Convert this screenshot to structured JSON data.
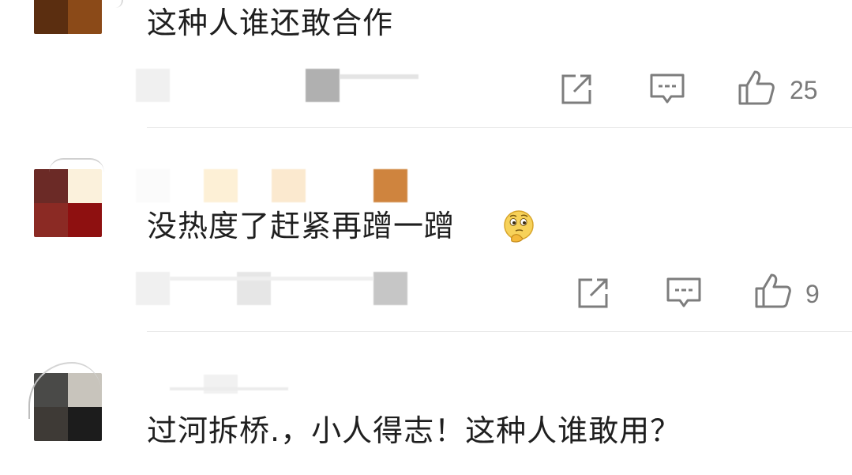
{
  "comments": [
    {
      "text": "这种人谁还敢合作",
      "like_count": "25"
    },
    {
      "text": "没热度了赶紧再蹭一蹭",
      "emoji": "thinking-face-emoji",
      "like_count": "9"
    },
    {
      "text": "过河拆桥.，小人得志！这种人谁敢用？"
    }
  ],
  "icons": {
    "share": "share-icon",
    "reply": "reply-icon",
    "like": "thumbs-up-icon"
  },
  "colors": {
    "text": "#1f1f1f",
    "icon": "#7d7d7d",
    "divider": "#e8e8e8"
  }
}
